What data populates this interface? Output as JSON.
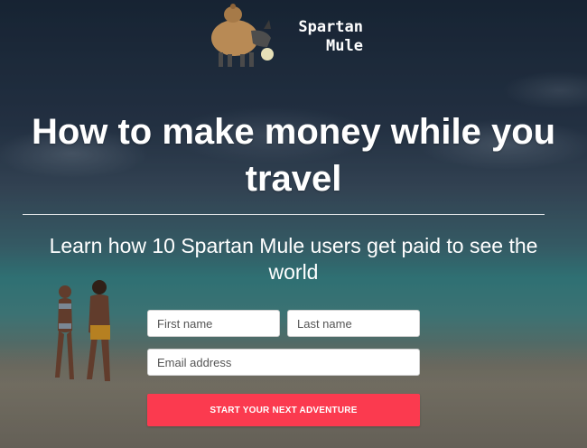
{
  "logo": {
    "line1": "Spartan",
    "line2": "Mule",
    "icon": "mule-mascot-icon"
  },
  "hero": {
    "headline": "How to make money while you travel",
    "subheadline": "Learn how 10 Spartan Mule users get paid to see the world"
  },
  "form": {
    "first_name_placeholder": "First name",
    "last_name_placeholder": "Last name",
    "email_placeholder": "Email address",
    "submit_label": "START YOUR NEXT ADVENTURE"
  },
  "colors": {
    "cta": "#fb3a4f",
    "text": "#ffffff"
  }
}
